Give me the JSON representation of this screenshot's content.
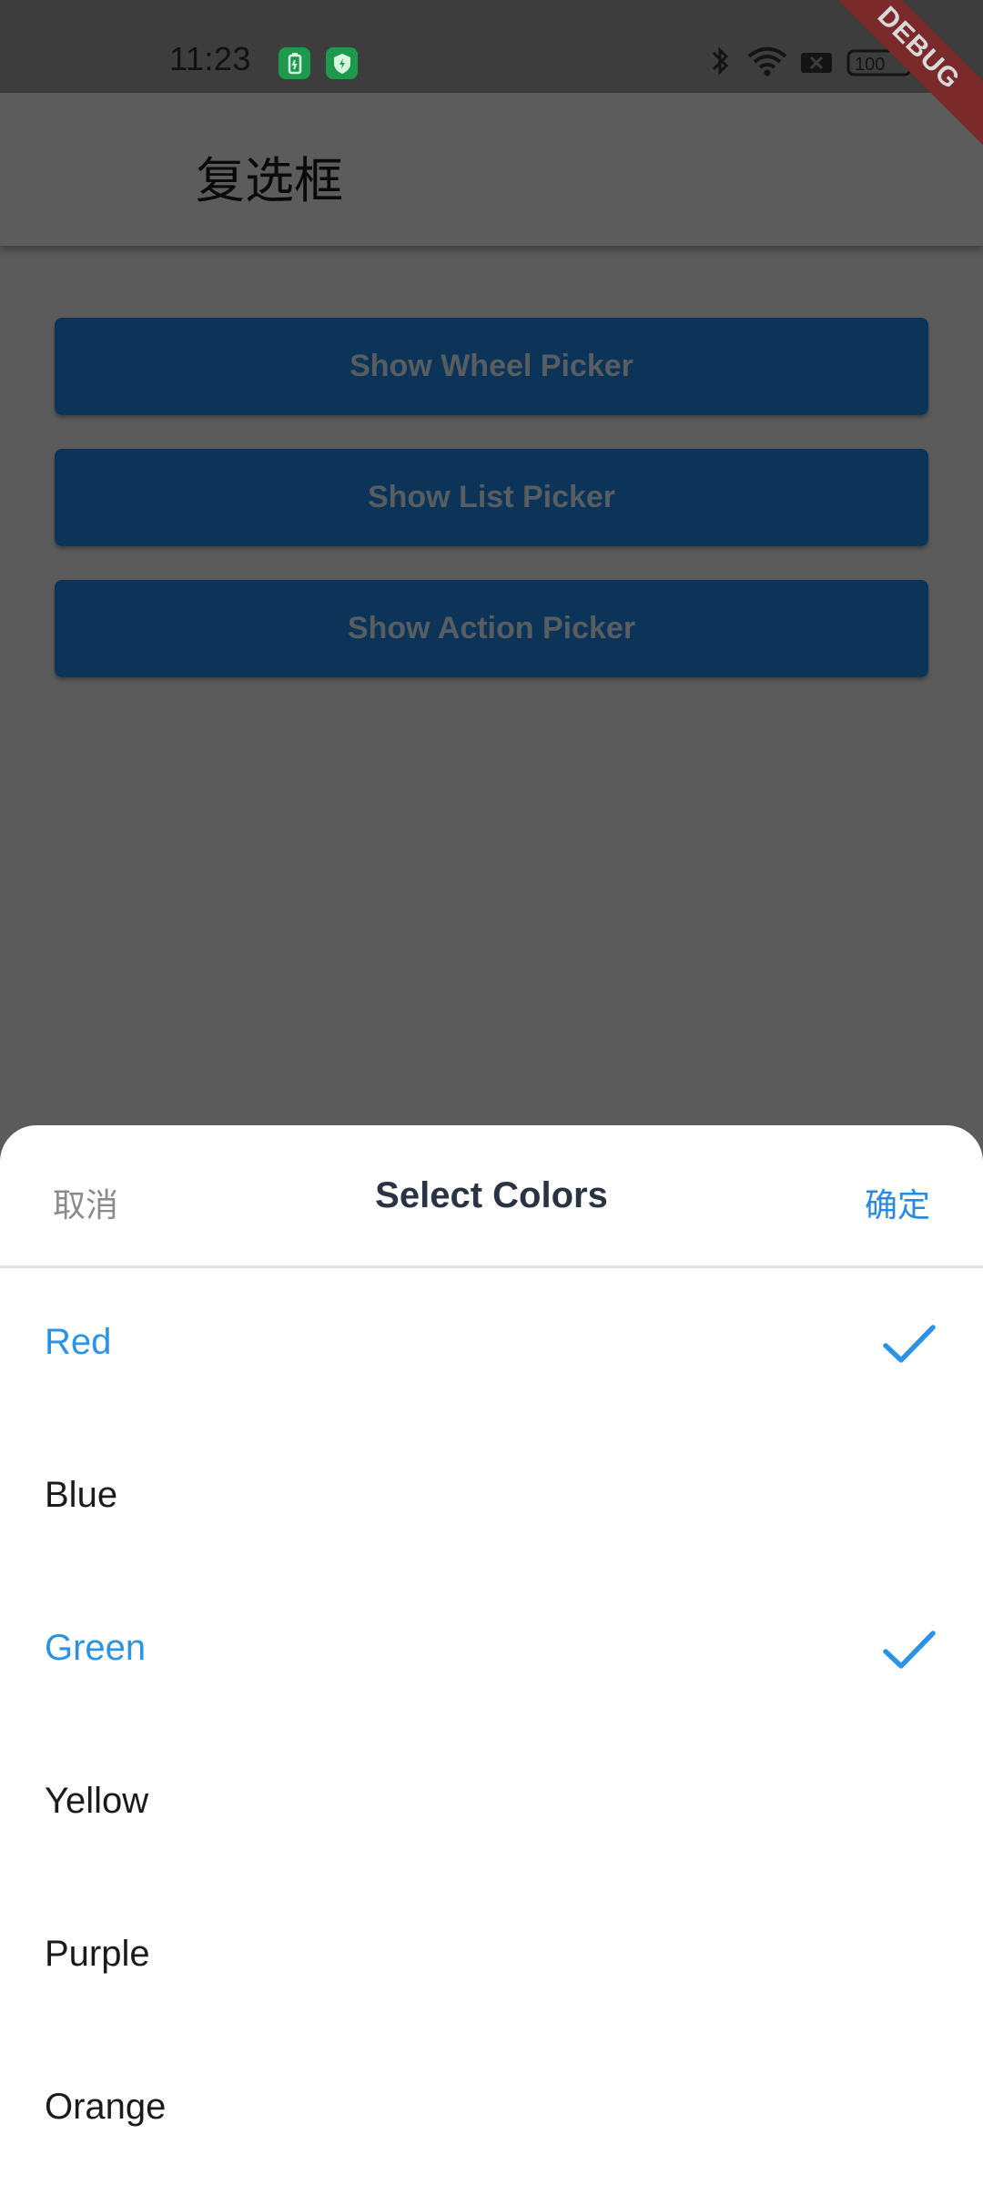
{
  "status_bar": {
    "time": "11:23",
    "battery_level": "100",
    "icons": [
      "battery-saver-app-icon",
      "shield-app-icon",
      "bluetooth-icon",
      "wifi-icon",
      "notification-muted-icon",
      "battery-icon"
    ]
  },
  "debug_banner": "DEBUG",
  "app_bar": {
    "title": "复选框"
  },
  "buttons": [
    {
      "label": "Show Wheel Picker"
    },
    {
      "label": "Show List Picker"
    },
    {
      "label": "Show Action Picker"
    }
  ],
  "sheet": {
    "cancel_label": "取消",
    "title": "Select Colors",
    "confirm_label": "确定",
    "options": [
      {
        "label": "Red",
        "selected": true
      },
      {
        "label": "Blue",
        "selected": false
      },
      {
        "label": "Green",
        "selected": true
      },
      {
        "label": "Yellow",
        "selected": false
      },
      {
        "label": "Purple",
        "selected": false
      },
      {
        "label": "Orange",
        "selected": false
      }
    ]
  },
  "colors": {
    "accent": "#2b93e6",
    "button_bg": "#0c3458",
    "scrim": "#5b5b5b",
    "debug_banner": "#7a2a2a"
  }
}
